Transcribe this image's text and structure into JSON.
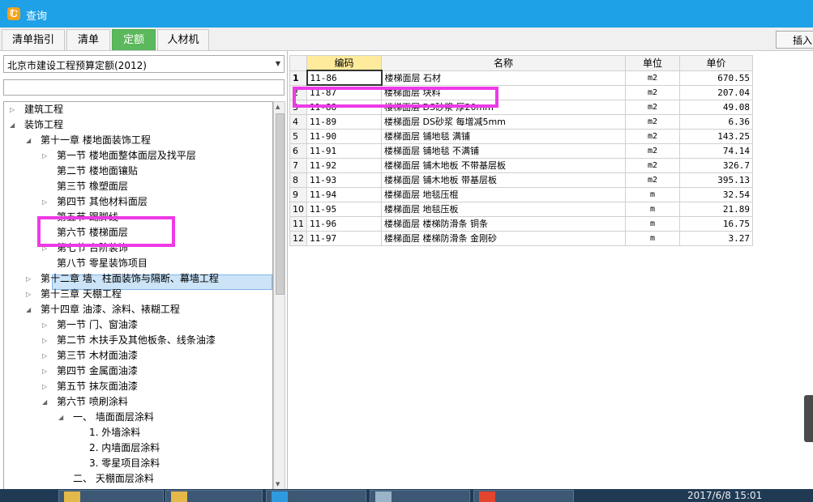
{
  "window": {
    "title": "查询"
  },
  "tabs": [
    {
      "label": "清单指引",
      "active": false
    },
    {
      "label": "清单",
      "active": false
    },
    {
      "label": "定额",
      "active": true
    },
    {
      "label": "人材机",
      "active": false
    }
  ],
  "toolbar": {
    "insert_label": "插入"
  },
  "left_panel": {
    "quota_library": "北京市建设工程预算定额(2012)",
    "search_value": "",
    "tree": [
      {
        "label": "建筑工程",
        "level": 0,
        "expander": "collapsed"
      },
      {
        "label": "装饰工程",
        "level": 0,
        "expander": "expanded"
      },
      {
        "label": "第十一章 楼地面装饰工程",
        "level": 1,
        "expander": "expanded"
      },
      {
        "label": "第一节 楼地面整体面层及找平层",
        "level": 2,
        "expander": "collapsed"
      },
      {
        "label": "第二节 楼地面镶贴",
        "level": 2,
        "expander": "none"
      },
      {
        "label": "第三节 橡塑面层",
        "level": 2,
        "expander": "none"
      },
      {
        "label": "第四节 其他材料面层",
        "level": 2,
        "expander": "collapsed"
      },
      {
        "label": "第五节 踢脚线",
        "level": 2,
        "expander": "none"
      },
      {
        "label": "第六节 楼梯面层",
        "level": 2,
        "expander": "none",
        "selected": true
      },
      {
        "label": "第七节 台阶装饰",
        "level": 2,
        "expander": "collapsed"
      },
      {
        "label": "第八节 零星装饰项目",
        "level": 2,
        "expander": "none"
      },
      {
        "label": "第十二章 墙、柱面装饰与隔断、幕墙工程",
        "level": 1,
        "expander": "collapsed"
      },
      {
        "label": "第十三章 天棚工程",
        "level": 1,
        "expander": "collapsed"
      },
      {
        "label": "第十四章 油漆、涂料、裱糊工程",
        "level": 1,
        "expander": "expanded"
      },
      {
        "label": "第一节 门、窗油漆",
        "level": 2,
        "expander": "collapsed"
      },
      {
        "label": "第二节 木扶手及其他板条、线条油漆",
        "level": 2,
        "expander": "collapsed"
      },
      {
        "label": "第三节 木材面油漆",
        "level": 2,
        "expander": "collapsed"
      },
      {
        "label": "第四节 金属面油漆",
        "level": 2,
        "expander": "collapsed"
      },
      {
        "label": "第五节 抹灰面油漆",
        "level": 2,
        "expander": "collapsed"
      },
      {
        "label": "第六节 喷刷涂料",
        "level": 2,
        "expander": "expanded"
      },
      {
        "label": "一、 墙面面层涂料",
        "level": 3,
        "expander": "expanded"
      },
      {
        "label": "1. 外墙涂料",
        "level": 4,
        "expander": "none"
      },
      {
        "label": "2. 内墙面层涂料",
        "level": 4,
        "expander": "none"
      },
      {
        "label": "3. 零星项目涂料",
        "level": 4,
        "expander": "none"
      },
      {
        "label": "二、 天棚面层涂料",
        "level": 3,
        "expander": "none"
      }
    ]
  },
  "grid": {
    "columns": [
      "编码",
      "名称",
      "单位",
      "单价"
    ],
    "rows": [
      {
        "n": "1",
        "code": "11-86",
        "name": "楼梯面层 石材",
        "unit": "m2",
        "price": "670.55"
      },
      {
        "n": "2",
        "code": "11-87",
        "name": "楼梯面层 块料",
        "unit": "m2",
        "price": "207.04"
      },
      {
        "n": "3",
        "code": "11-88",
        "name": "楼梯面层 DS砂浆 厚20mm",
        "unit": "m2",
        "price": "49.08"
      },
      {
        "n": "4",
        "code": "11-89",
        "name": "楼梯面层 DS砂浆 每增减5mm",
        "unit": "m2",
        "price": "6.36"
      },
      {
        "n": "5",
        "code": "11-90",
        "name": "楼梯面层 铺地毯 满铺",
        "unit": "m2",
        "price": "143.25"
      },
      {
        "n": "6",
        "code": "11-91",
        "name": "楼梯面层 铺地毯 不满铺",
        "unit": "m2",
        "price": "74.14"
      },
      {
        "n": "7",
        "code": "11-92",
        "name": "楼梯面层 铺木地板 不带基层板",
        "unit": "m2",
        "price": "326.7"
      },
      {
        "n": "8",
        "code": "11-93",
        "name": "楼梯面层 铺木地板 带基层板",
        "unit": "m2",
        "price": "395.13"
      },
      {
        "n": "9",
        "code": "11-94",
        "name": "楼梯面层 地毯压棍",
        "unit": "m",
        "price": "32.54"
      },
      {
        "n": "10",
        "code": "11-95",
        "name": "楼梯面层 地毯压板",
        "unit": "m",
        "price": "21.89"
      },
      {
        "n": "11",
        "code": "11-96",
        "name": "楼梯面层 楼梯防滑条 铜条",
        "unit": "m",
        "price": "16.75"
      },
      {
        "n": "12",
        "code": "11-97",
        "name": "楼梯面层 楼梯防滑条 金刚砂",
        "unit": "m",
        "price": "3.27"
      }
    ]
  },
  "taskbar": {
    "clock": "2017/6/8 15:01"
  },
  "colors": {
    "titlebar": "#1ea1e6",
    "active_tab": "#5cb85c",
    "highlight": "#ee3ae6",
    "sorted_header": "#ffeb9c"
  }
}
